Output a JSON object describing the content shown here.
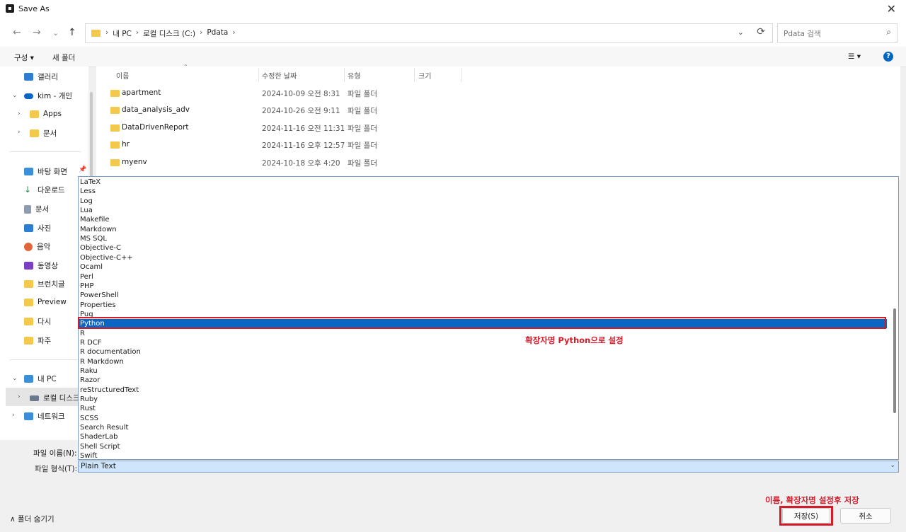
{
  "window": {
    "title": "Save As",
    "close_glyph": "✕"
  },
  "nav": {
    "back": "←",
    "forward": "→",
    "recent": "⌄",
    "up": "↑"
  },
  "address": {
    "crumbs": [
      "내 PC",
      "로컬 디스크 (C:)",
      "Pdata"
    ],
    "separator": "›",
    "dropdown": "⌄",
    "refresh": "⟳"
  },
  "search": {
    "placeholder": "Pdata 검색",
    "icon": "search-icon"
  },
  "toolbar": {
    "organize": "구성 ▾",
    "new_folder": "새 폴더",
    "view": "☰ ▾",
    "help": "?"
  },
  "sidebar": {
    "items": [
      {
        "label": "갤러리",
        "icon": "gallery-icon",
        "color": "#2d7dd2"
      },
      {
        "label": "kim - 개인",
        "icon": "cloud-icon",
        "color": "#0a66c4"
      },
      {
        "label": "Apps",
        "icon": "folder-icon",
        "color": "#f2c94c"
      },
      {
        "label": "문서",
        "icon": "folder-icon",
        "color": "#f2c94c"
      },
      {
        "label": "바탕 화면",
        "icon": "desktop-icon",
        "color": "#3b8fd9"
      },
      {
        "label": "다운로드",
        "icon": "download-icon",
        "color": "#2e8b57"
      },
      {
        "label": "문서",
        "icon": "document-icon",
        "color": "#8e9bb0"
      },
      {
        "label": "사진",
        "icon": "picture-icon",
        "color": "#2d7dd2"
      },
      {
        "label": "음악",
        "icon": "music-icon",
        "color": "#e0663a"
      },
      {
        "label": "동영상",
        "icon": "video-icon",
        "color": "#7b3fc4"
      },
      {
        "label": "브런치글",
        "icon": "folder-icon",
        "color": "#f2c94c"
      },
      {
        "label": "Preview",
        "icon": "folder-icon",
        "color": "#f2c94c"
      },
      {
        "label": "다시",
        "icon": "folder-icon",
        "color": "#f2c94c"
      },
      {
        "label": "파주",
        "icon": "folder-icon",
        "color": "#f2c94c"
      },
      {
        "label": "내 PC",
        "icon": "computer-icon",
        "color": "#3b8fd9"
      },
      {
        "label": "로컬 디스크",
        "icon": "drive-icon",
        "color": "#6a7a8c"
      },
      {
        "label": "네트워크",
        "icon": "network-icon",
        "color": "#3b8fd9"
      }
    ]
  },
  "file_list": {
    "columns": [
      "이름",
      "수정한 날짜",
      "유형",
      "크기"
    ],
    "rows": [
      {
        "name": "apartment",
        "date": "2024-10-09 오전 8:31",
        "type": "파일 폴더"
      },
      {
        "name": "data_analysis_adv",
        "date": "2024-10-26 오전 9:11",
        "type": "파일 폴더"
      },
      {
        "name": "DataDrivenReport",
        "date": "2024-11-16 오전 11:31",
        "type": "파일 폴더"
      },
      {
        "name": "hr",
        "date": "2024-11-16 오후 12:57",
        "type": "파일 폴더"
      },
      {
        "name": "myenv",
        "date": "2024-10-18 오후 4:20",
        "type": "파일 폴더"
      }
    ]
  },
  "type_options": [
    "LaTeX",
    "Less",
    "Log",
    "Lua",
    "Makefile",
    "Markdown",
    "MS SQL",
    "Objective-C",
    "Objective-C++",
    "Ocaml",
    "Perl",
    "PHP",
    "PowerShell",
    "Properties",
    "Pug",
    "Python",
    "R",
    "R DCF",
    "R documentation",
    "R Markdown",
    "Raku",
    "Razor",
    "reStructuredText",
    "Ruby",
    "Rust",
    "SCSS",
    "Search Result",
    "ShaderLab",
    "Shell Script",
    "Swift"
  ],
  "selected_type_index": 15,
  "annotations": {
    "python": "확장자명 Python으로 설정",
    "save": "이름, 확장자명 설정후 저장"
  },
  "form": {
    "filename_label": "파일 이름(N):",
    "type_label": "파일 형식(T):",
    "type_value": "Plain Text"
  },
  "footer": {
    "hide_folders": "∧  폴더 숨기기",
    "save": "저장(S)",
    "cancel": "취소"
  },
  "colors": {
    "accent": "#0a66c4",
    "annotation": "#d11c2a",
    "folder": "#f2c94c"
  }
}
